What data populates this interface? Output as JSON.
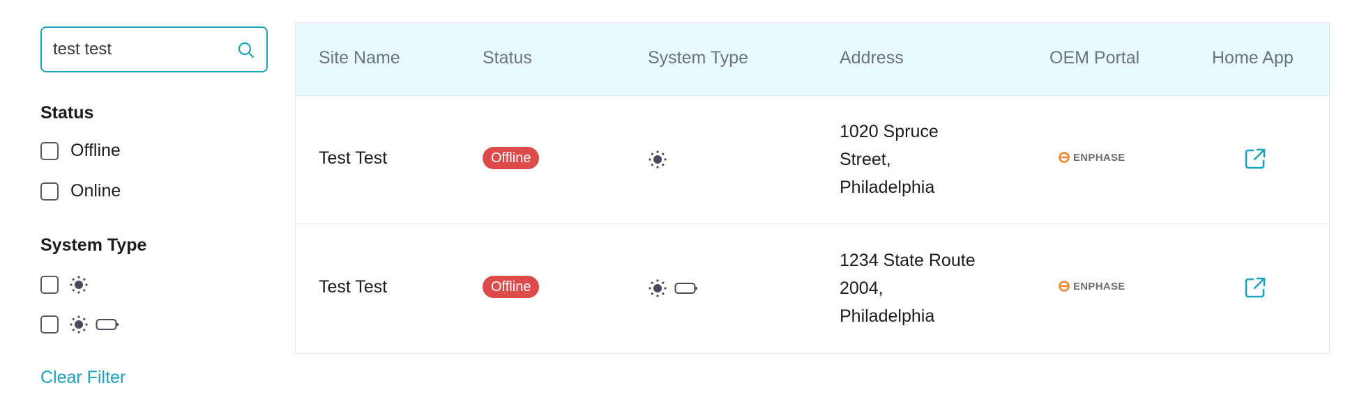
{
  "search": {
    "value": "test test",
    "icon": "search-icon"
  },
  "filters": {
    "status": {
      "title": "Status",
      "options": [
        {
          "label": "Offline",
          "checked": false
        },
        {
          "label": "Online",
          "checked": false
        }
      ]
    },
    "system_type": {
      "title": "System Type",
      "options": [
        {
          "icons": [
            "sun-icon"
          ],
          "checked": false
        },
        {
          "icons": [
            "sun-icon",
            "battery-icon"
          ],
          "checked": false
        }
      ]
    },
    "clear_label": "Clear Filter"
  },
  "table": {
    "columns": [
      "Site Name",
      "Status",
      "System Type",
      "Address",
      "OEM Portal",
      "Home App"
    ],
    "rows": [
      {
        "site_name": "Test Test",
        "status": "Offline",
        "system_type": [
          "sun-icon"
        ],
        "address": [
          "1020 Spruce",
          "Street,",
          "Philadelphia"
        ],
        "oem_portal": "ENPHASE",
        "home_app_icon": "external-link-icon"
      },
      {
        "site_name": "Test Test",
        "status": "Offline",
        "system_type": [
          "sun-icon",
          "battery-icon"
        ],
        "address": [
          "1234 State Route",
          "2004,",
          "Philadelphia"
        ],
        "oem_portal": "ENPHASE",
        "home_app_icon": "external-link-icon"
      }
    ]
  },
  "colors": {
    "accent": "#1aa3bd",
    "header_bg": "#e8fafd",
    "offline_badge": "#dc4a4a",
    "enphase_orange": "#f07f21",
    "icon_gray": "#4a4a5a"
  }
}
